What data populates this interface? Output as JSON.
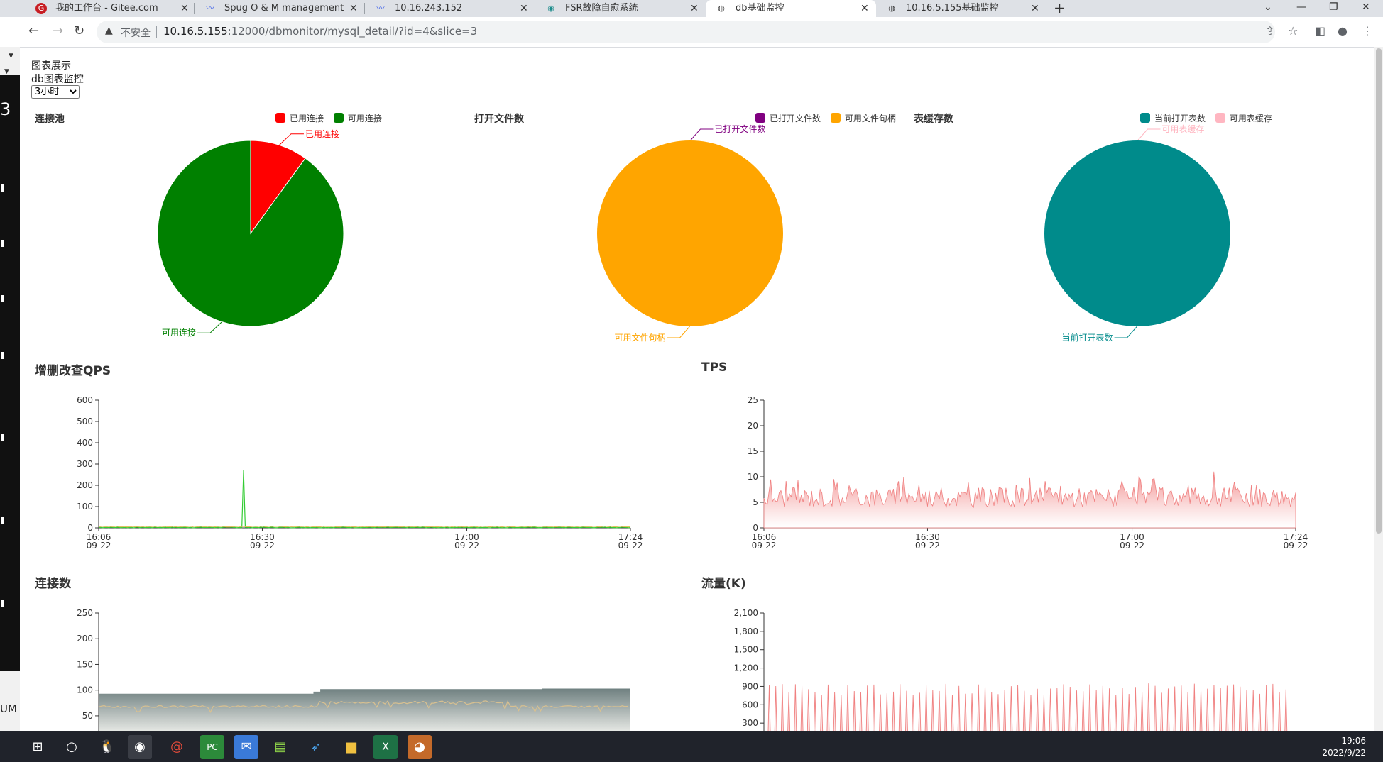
{
  "browser": {
    "tabs": [
      {
        "label": "我的工作台 - Gitee.com",
        "icon": "gitee-icon",
        "active": false
      },
      {
        "label": "Spug O & M management sys",
        "icon": "spug-icon",
        "active": false
      },
      {
        "label": "10.16.243.152",
        "icon": "spug-icon",
        "active": false
      },
      {
        "label": "FSR故障自愈系统",
        "icon": "fsr-icon",
        "active": false
      },
      {
        "label": "db基础监控",
        "icon": "globe-icon",
        "active": true
      },
      {
        "label": "10.16.5.155基础监控",
        "icon": "globe-icon",
        "active": false
      }
    ],
    "address": {
      "security_label": "不安全",
      "host": "10.16.5.155",
      "path": ":12000/dbmonitor/mysql_detail/?id=4&slice=3"
    }
  },
  "page": {
    "heading": "图表展示",
    "subheading": "db图表监控",
    "range_select": {
      "value": "3小时",
      "options": [
        "3小时"
      ]
    }
  },
  "pies": [
    {
      "title": "连接池",
      "legend": [
        "已用连接",
        "可用连接"
      ],
      "slices": [
        {
          "name": "已用连接",
          "fraction": 0.1,
          "color": "#ff0000"
        },
        {
          "name": "可用连接",
          "fraction": 0.9,
          "color": "#008000"
        }
      ]
    },
    {
      "title": "打开文件数",
      "legend": [
        "已打开文件数",
        "可用文件句柄"
      ],
      "slices": [
        {
          "name": "已打开文件数",
          "fraction": 0.001,
          "color": "#800080"
        },
        {
          "name": "可用文件句柄",
          "fraction": 0.999,
          "color": "#ffa500"
        }
      ]
    },
    {
      "title": "表缓存数",
      "legend": [
        "当前打开表数",
        "可用表缓存"
      ],
      "slices": [
        {
          "name": "可用表缓存",
          "fraction": 0.001,
          "color": "#ffb6c1"
        },
        {
          "name": "当前打开表数",
          "fraction": 0.999,
          "color": "#008b8b"
        }
      ]
    }
  ],
  "chart_data": [
    {
      "type": "pie",
      "title": "连接池",
      "labels": [
        "已用连接",
        "可用连接"
      ],
      "values": [
        10,
        90
      ]
    },
    {
      "type": "pie",
      "title": "打开文件数",
      "labels": [
        "已打开文件数",
        "可用文件句柄"
      ],
      "values": [
        0.1,
        99.9
      ]
    },
    {
      "type": "pie",
      "title": "表缓存数",
      "labels": [
        "当前打开表数",
        "可用表缓存"
      ],
      "values": [
        99.9,
        0.1
      ]
    },
    {
      "type": "line",
      "title": "增删改查QPS",
      "x_ticks": [
        [
          "16:06",
          "09-22"
        ],
        [
          "16:30",
          "09-22"
        ],
        [
          "17:00",
          "09-22"
        ],
        [
          "17:24",
          "09-22"
        ]
      ],
      "x_range_minutes": [
        0,
        78
      ],
      "ylim": [
        0,
        600
      ],
      "y_ticks": [
        "0",
        "100",
        "200",
        "300",
        "400",
        "500",
        "600"
      ],
      "series": [
        {
          "color": "#33cc33",
          "baseline": 2,
          "spikes": [
            [
              21.2,
              270
            ]
          ]
        },
        {
          "color": "#e0c060",
          "baseline": 6,
          "spikes": []
        }
      ]
    },
    {
      "type": "area",
      "title": "TPS",
      "x_ticks": [
        [
          "16:06",
          "09-22"
        ],
        [
          "16:30",
          "09-22"
        ],
        [
          "17:00",
          "09-22"
        ],
        [
          "17:24",
          "09-22"
        ]
      ],
      "x_range_minutes": [
        0,
        78
      ],
      "ylim": [
        0,
        25
      ],
      "y_ticks": [
        "0",
        "5",
        "10",
        "15",
        "20",
        "25"
      ],
      "series": [
        {
          "color": "#f08080",
          "baseline": 5.5,
          "range": [
            4,
            8
          ],
          "spikes": [
            [
              20.6,
              10
            ],
            [
              57,
              9.5
            ],
            [
              66,
              11
            ],
            [
              69,
              9
            ]
          ]
        }
      ]
    },
    {
      "type": "area",
      "title": "连接数",
      "ylim": [
        0,
        250
      ],
      "visible_ylim": [
        40,
        250
      ],
      "y_ticks": [
        "50",
        "100",
        "150",
        "200",
        "250"
      ],
      "series": [
        {
          "color": "#5f7373",
          "steps": [
            [
              0,
              93
            ],
            [
              31.5,
              97
            ],
            [
              32.5,
              102
            ],
            [
              65,
              103
            ]
          ]
        },
        {
          "color": "#d8c090",
          "baseline": 68,
          "range": [
            58,
            80
          ]
        }
      ]
    },
    {
      "type": "area",
      "title": "流量(K)",
      "ylim": [
        0,
        2100
      ],
      "visible_ylim": [
        200,
        2100
      ],
      "y_ticks": [
        "300",
        "600",
        "900",
        "1,200",
        "1,500",
        "1,800",
        "2,100"
      ],
      "series": [
        {
          "color": "#f08080",
          "peak": 850,
          "range": [
            750,
            950
          ],
          "pulses": 80
        }
      ]
    }
  ],
  "line_charts": [
    {
      "title": "增删改查QPS"
    },
    {
      "title": "TPS"
    },
    {
      "title": "连接数"
    },
    {
      "title": "流量(K)"
    }
  ],
  "taskbar": {
    "apps": [
      "windows-icon",
      "search-icon",
      "qq-icon",
      "chrome-icon",
      "snail-icon",
      "pycharm-icon",
      "mail-icon",
      "notepad-icon",
      "bird-icon",
      "folder-icon",
      "excel-icon",
      "wechat-icon"
    ],
    "time": "19:06",
    "date": "2022/9/22"
  },
  "side_window": {
    "text": "UM",
    "number": "3"
  }
}
